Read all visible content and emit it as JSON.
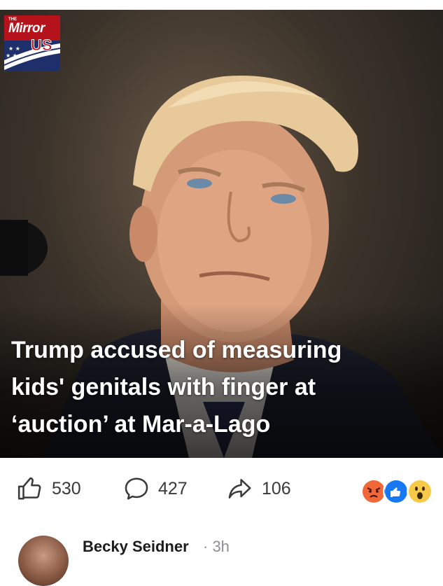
{
  "post": {
    "publisher_logo": {
      "line1": "THE",
      "line2": "Mirror",
      "line3": "US"
    },
    "headline": "Trump accused of measuring\nkids' genitals with finger at\n‘auction’ at Mar-a-Lago"
  },
  "actions": {
    "like_count": "530",
    "comment_count": "427",
    "share_count": "106"
  },
  "reactions": [
    "angry",
    "like",
    "wow"
  ],
  "comment": {
    "author": "Becky Seidner",
    "time": "· 3h"
  },
  "colors": {
    "brand_red": "#b5121b",
    "like_blue": "#1877f2",
    "angry_orange": "#f0683a",
    "wow_yellow": "#f7c948",
    "icon_gray": "#3a3a3c"
  }
}
